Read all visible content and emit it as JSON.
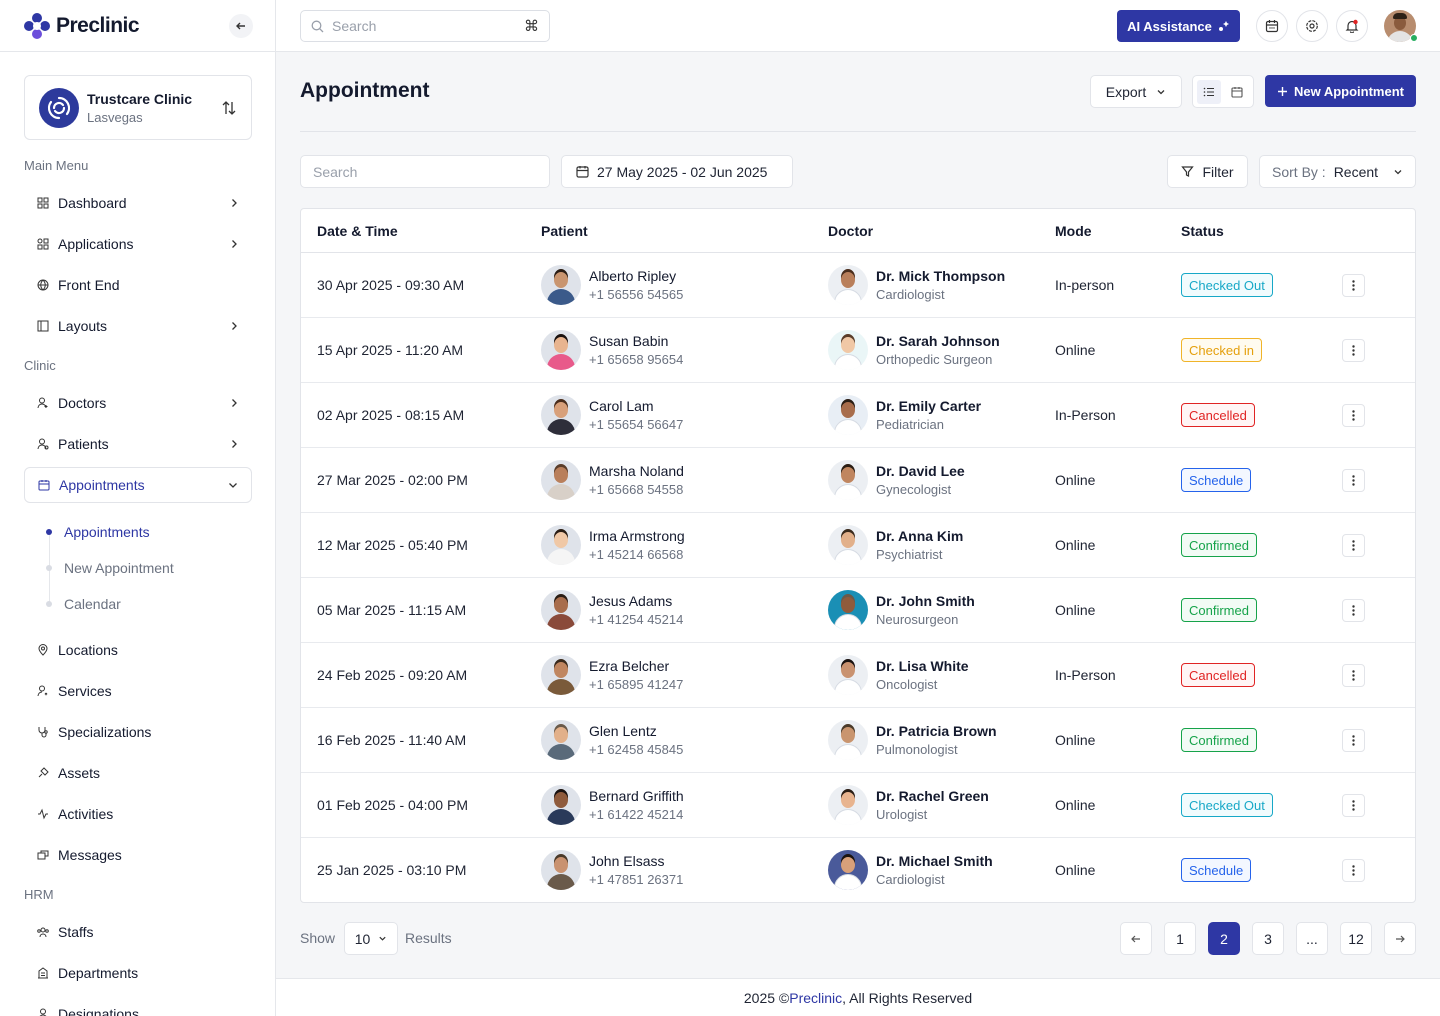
{
  "app": {
    "name": "Preclinic"
  },
  "clinic": {
    "name": "Trustcare Clinic",
    "location": "Lasvegas"
  },
  "sidebar": {
    "main_menu_label": "Main Menu",
    "clinic_label": "Clinic",
    "hrm_label": "HRM",
    "items": [
      {
        "label": "Dashboard",
        "icon": "grid-icon"
      },
      {
        "label": "Applications",
        "icon": "apps-icon"
      },
      {
        "label": "Front End",
        "icon": "globe-icon"
      },
      {
        "label": "Layouts",
        "icon": "layout-icon"
      },
      {
        "label": "Doctors",
        "icon": "doctor-icon"
      },
      {
        "label": "Patients",
        "icon": "patient-icon"
      },
      {
        "label": "Appointments",
        "icon": "calendar-icon"
      },
      {
        "label": "Locations",
        "icon": "location-icon"
      },
      {
        "label": "Services",
        "icon": "service-icon"
      },
      {
        "label": "Specializations",
        "icon": "stethoscope-icon"
      },
      {
        "label": "Assets",
        "icon": "asset-icon"
      },
      {
        "label": "Activities",
        "icon": "activity-icon"
      },
      {
        "label": "Messages",
        "icon": "message-icon"
      },
      {
        "label": "Staffs",
        "icon": "staff-icon"
      },
      {
        "label": "Departments",
        "icon": "building-icon"
      },
      {
        "label": "Designations",
        "icon": "designation-icon"
      }
    ],
    "sub_items": [
      "Appointments",
      "New Appointment",
      "Calendar"
    ]
  },
  "topbar": {
    "search_placeholder": "Search",
    "search_shortcut": "⌘",
    "ai_label": "AI Assistance"
  },
  "page": {
    "title": "Appointment",
    "export_label": "Export",
    "new_label": "New Appointment",
    "search_placeholder": "Search",
    "date_range": "27 May 2025 - 02 Jun 2025",
    "filter_label": "Filter",
    "sort_label": "Sort By :",
    "sort_value": "Recent"
  },
  "table": {
    "headers": [
      "Date & Time",
      "Patient",
      "Doctor",
      "Mode",
      "Status"
    ],
    "rows": [
      {
        "date": "30 Apr 2025 - 09:30 AM",
        "patient": "Alberto Ripley",
        "phone": "+1 56556 54565",
        "doctor": "Dr. Mick Thompson",
        "spec": "Cardiologist",
        "mode": "In-person",
        "status": "Checked Out",
        "status_key": "out"
      },
      {
        "date": "15 Apr 2025 - 11:20 AM",
        "patient": "Susan Babin",
        "phone": "+1 65658 95654",
        "doctor": "Dr. Sarah Johnson",
        "spec": "Orthopedic Surgeon",
        "mode": "Online",
        "status": "Checked in",
        "status_key": "in"
      },
      {
        "date": "02 Apr 2025 - 08:15 AM",
        "patient": "Carol Lam",
        "phone": "+1 55654 56647",
        "doctor": "Dr. Emily Carter",
        "spec": "Pediatrician",
        "mode": "In-Person",
        "status": "Cancelled",
        "status_key": "can"
      },
      {
        "date": "27 Mar 2025 - 02:00 PM",
        "patient": "Marsha Noland",
        "phone": "+1 65668 54558",
        "doctor": "Dr. David Lee",
        "spec": "Gynecologist",
        "mode": "Online",
        "status": "Schedule",
        "status_key": "sch"
      },
      {
        "date": "12 Mar 2025 - 05:40 PM",
        "patient": "Irma Armstrong",
        "phone": "+1 45214 66568",
        "doctor": "Dr. Anna Kim",
        "spec": "Psychiatrist",
        "mode": "Online",
        "status": "Confirmed",
        "status_key": "con"
      },
      {
        "date": "05 Mar 2025 - 11:15 AM",
        "patient": "Jesus Adams",
        "phone": "+1 41254 45214",
        "doctor": "Dr. John Smith",
        "spec": "Neurosurgeon",
        "mode": "Online",
        "status": "Confirmed",
        "status_key": "con"
      },
      {
        "date": "24 Feb 2025 - 09:20 AM",
        "patient": "Ezra Belcher",
        "phone": "+1 65895 41247",
        "doctor": "Dr. Lisa White",
        "spec": "Oncologist",
        "mode": "In-Person",
        "status": "Cancelled",
        "status_key": "can"
      },
      {
        "date": "16 Feb 2025 - 11:40 AM",
        "patient": "Glen Lentz",
        "phone": "+1 62458 45845",
        "doctor": "Dr. Patricia Brown",
        "spec": "Pulmonologist",
        "mode": "Online",
        "status": "Confirmed",
        "status_key": "con"
      },
      {
        "date": "01 Feb 2025 - 04:00 PM",
        "patient": "Bernard Griffith",
        "phone": "+1 61422 45214",
        "doctor": "Dr. Rachel Green",
        "spec": "Urologist",
        "mode": "Online",
        "status": "Checked Out",
        "status_key": "out"
      },
      {
        "date": "25 Jan 2025 - 03:10 PM",
        "patient": "John Elsass",
        "phone": "+1 47851 26371",
        "doctor": "Dr. Michael Smith",
        "spec": "Cardiologist",
        "mode": "Online",
        "status": "Schedule",
        "status_key": "sch"
      }
    ]
  },
  "pagination": {
    "show_label": "Show",
    "per_page": "10",
    "results_label": "Results",
    "pages": [
      "1",
      "2",
      "3",
      "...",
      "12"
    ],
    "current": "2"
  },
  "footer": {
    "year": "2025 © ",
    "brand": "Preclinic",
    "rest": ", All Rights Reserved"
  },
  "colors": {
    "accent": "#2e37a4"
  }
}
